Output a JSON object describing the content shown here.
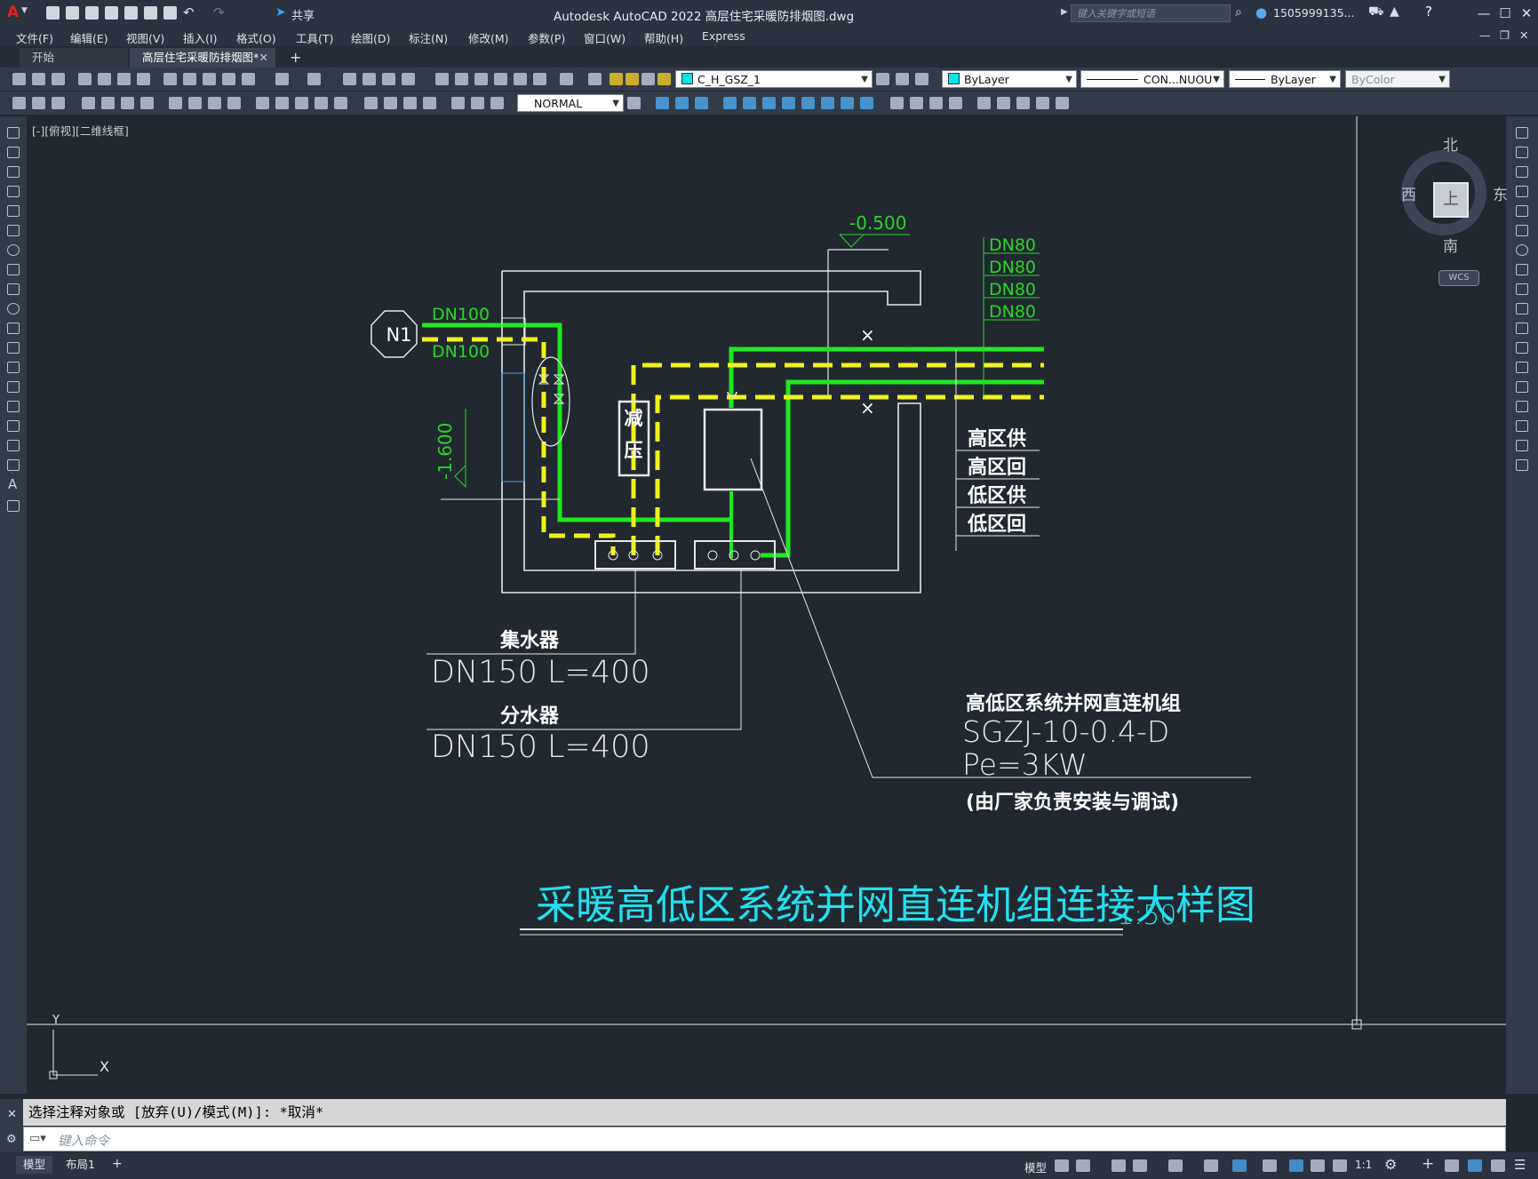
{
  "app": {
    "title": "Autodesk AutoCAD 2022    高层住宅采暖防排烟图.dwg",
    "share_label": "共享",
    "search_placeholder": "键入关键字或短语",
    "user": "1505999135...",
    "logo_letter": "A"
  },
  "menu": [
    "文件(F)",
    "编辑(E)",
    "视图(V)",
    "插入(I)",
    "格式(O)",
    "工具(T)",
    "绘图(D)",
    "标注(N)",
    "修改(M)",
    "参数(P)",
    "窗口(W)",
    "帮助(H)",
    "Express"
  ],
  "tabs": [
    {
      "label": "开始",
      "active": false
    },
    {
      "label": "高层住宅采暖防排烟图*",
      "active": true
    }
  ],
  "toolbar": {
    "layer": "C_H_GSZ_1",
    "color": "ByLayer",
    "linetype": "CON...NUOU",
    "lineweight": "ByLayer",
    "plotstyle": "ByColor",
    "dimstyle": "NORMAL"
  },
  "viewport_label": "[-][俯视][二维线框]",
  "viewcube": {
    "north": "北",
    "south": "南",
    "east": "东",
    "west": "西",
    "face": "上",
    "wcs": "WCS"
  },
  "drawing": {
    "elevation_top": "-0.500",
    "elevation_left": "-1.600",
    "node_label": "N1",
    "pipe_dn100_supply": "DN100",
    "pipe_dn100_return": "DN100",
    "pipe_dn80": [
      "DN80",
      "DN80",
      "DN80",
      "DN80"
    ],
    "pressure_reducer": "减压",
    "legend": [
      "高区供",
      "高区回",
      "低区供",
      "低区回"
    ],
    "collector_name": "集水器",
    "collector_spec": "DN150  L=400",
    "distributor_name": "分水器",
    "distributor_spec": "DN150  L=400",
    "unit_name": "高低区系统并网直连机组",
    "unit_model": "SGZJ-10-0.4-D",
    "unit_power": "Pe=3KW",
    "unit_note": "(由厂家负责安装与调试)",
    "title": "采暖高低区系统并网直连机组连接大样图",
    "scale": "1:50",
    "ucs_x": "X",
    "ucs_y": "Y"
  },
  "command": {
    "history": "选择注释对象或 [放弃(U)/模式(M)]: *取消*",
    "placeholder": "键入命令"
  },
  "status": {
    "layout_tabs": [
      "模型",
      "布局1"
    ],
    "model_label": "模型",
    "scale": "1:1"
  },
  "colors": {
    "canvas": "#212830",
    "supply_pipe": "#1ee81e",
    "return_pipe": "#f2f21a",
    "annotation_green": "#28d628",
    "title_cyan": "#22e0f0",
    "linework": "#e8e8e8"
  }
}
